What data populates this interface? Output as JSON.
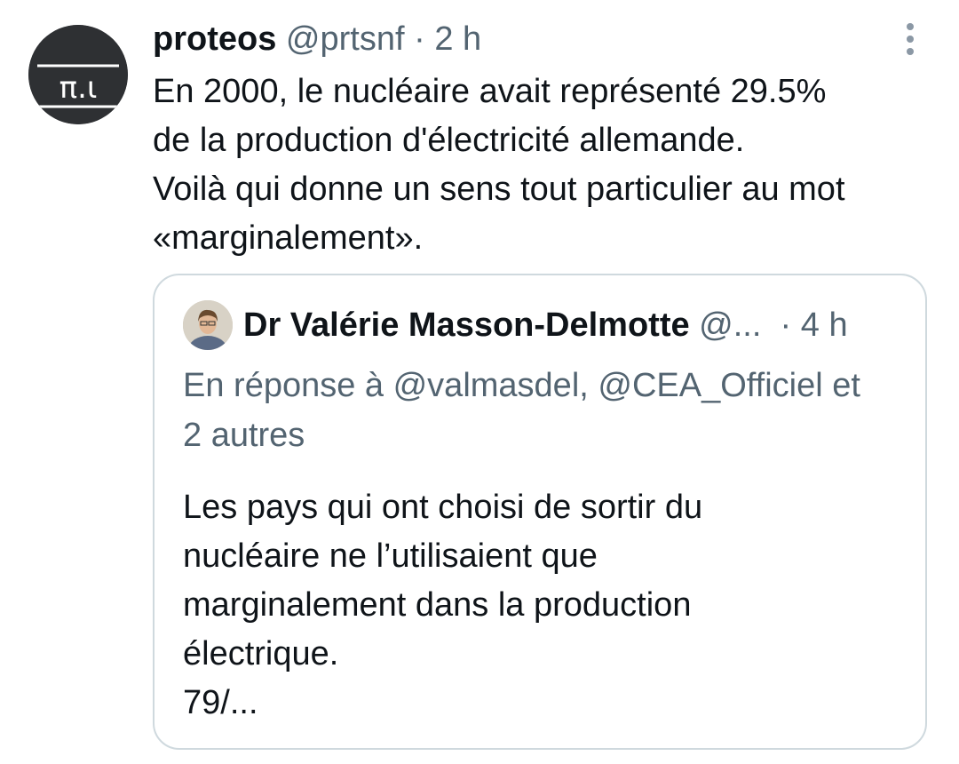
{
  "tweet": {
    "author_name": "proteos",
    "author_handle": "@prtsnf",
    "time": "2 h",
    "separator": " · ",
    "avatar_text": "π.ι",
    "text_lines": [
      "En 2000, le nucléaire avait représenté 29.5%",
      "de la production d'électricité allemande.",
      "Voilà qui donne un sens tout particulier au mot",
      "«marginalement»."
    ]
  },
  "quoted_tweet": {
    "author_name": "Dr Valérie Masson-Delmotte",
    "author_handle": "@...",
    "separator": "·",
    "time": "4 h",
    "reply_lines": [
      "En réponse à @valmasdel, @CEA_Officiel et",
      "2 autres"
    ],
    "text_lines": [
      "Les pays qui ont choisi de sortir du",
      "nucléaire ne l’utilisaient que",
      "marginalement dans la production",
      "électrique.",
      "79/..."
    ]
  },
  "icons": {
    "more": "more-vertical-icon"
  },
  "colors": {
    "text_primary": "#0f1419",
    "text_secondary": "#536471",
    "border": "#cfd9de",
    "avatar_bg": "#2e3033"
  }
}
